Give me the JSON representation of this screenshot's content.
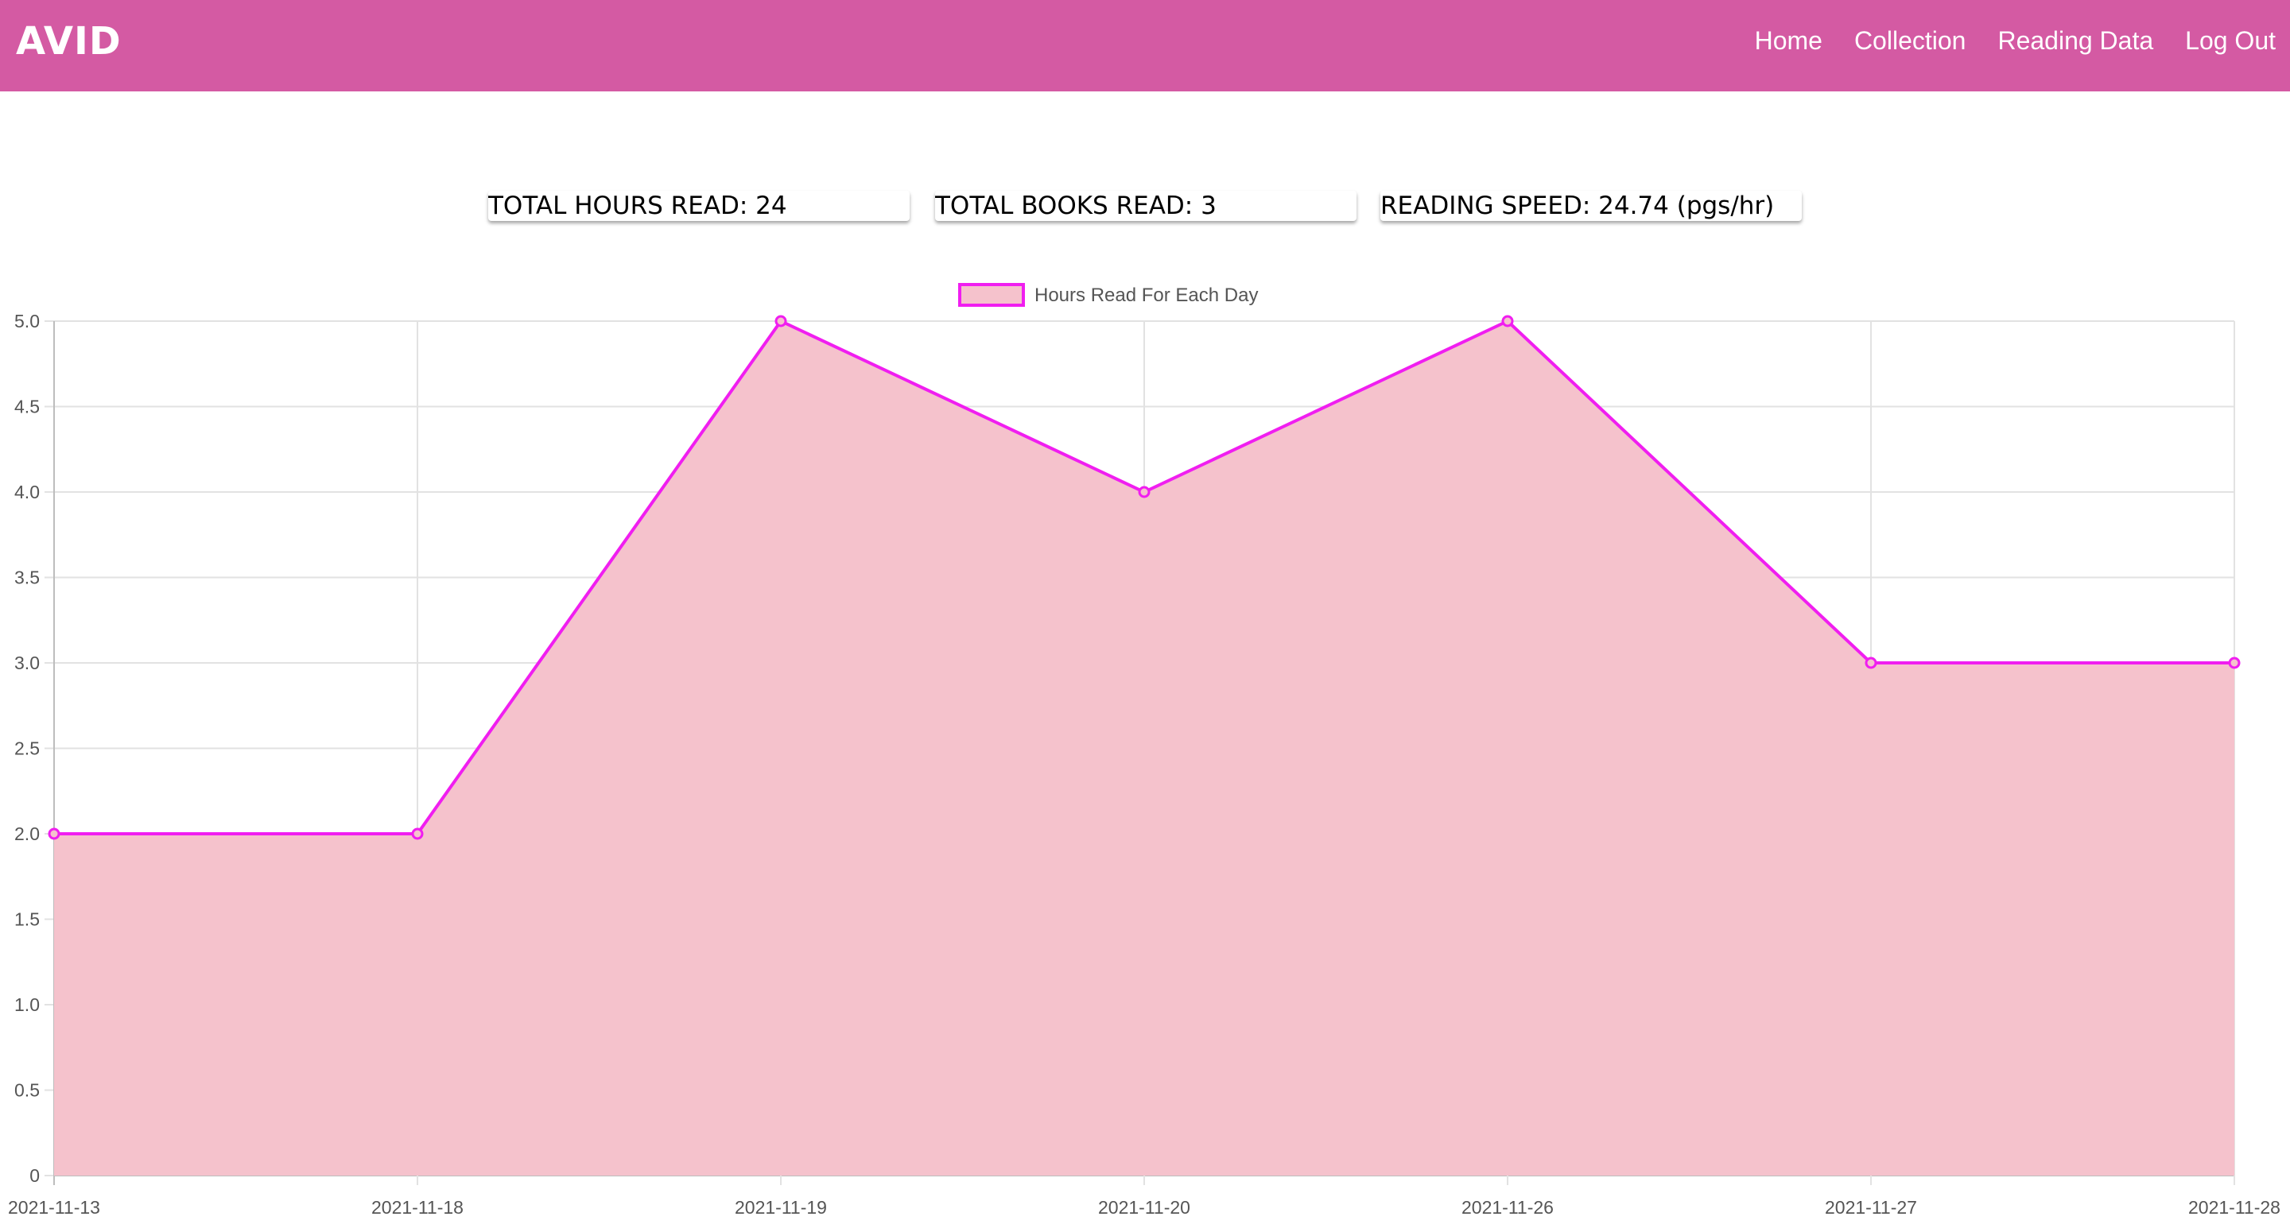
{
  "nav": {
    "brand": "AVID",
    "links": [
      "Home",
      "Collection",
      "Reading Data",
      "Log Out"
    ]
  },
  "stats": {
    "hours": "TOTAL HOURS READ: 24",
    "books": "TOTAL BOOKS READ: 3",
    "speed": "READING SPEED: 24.74 (pgs/hr)"
  },
  "colors": {
    "navbar": "#d45aa3",
    "line": "#f01ef0",
    "fill": "#f5c2cc",
    "grid": "#e2e2e2"
  },
  "chart_data": {
    "type": "area",
    "categories": [
      "2021-11-13",
      "2021-11-18",
      "2021-11-19",
      "2021-11-20",
      "2021-11-26",
      "2021-11-27",
      "2021-11-28"
    ],
    "series": [
      {
        "name": "Hours Read For Each Day",
        "values": [
          2,
          2,
          5,
          4,
          5,
          3,
          3
        ]
      }
    ],
    "ylim": [
      0,
      5
    ],
    "yticks": [
      "0",
      "0.5",
      "1.0",
      "1.5",
      "2.0",
      "2.5",
      "3.0",
      "3.5",
      "4.0",
      "4.5",
      "5.0"
    ],
    "grid": true,
    "legend": "top-center"
  }
}
